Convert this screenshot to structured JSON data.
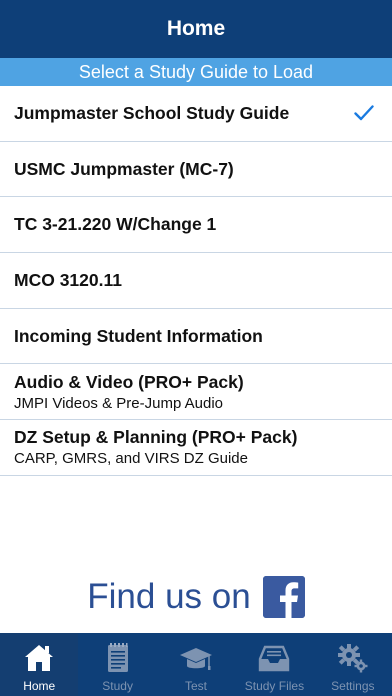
{
  "navbar": {
    "title": "Home"
  },
  "subheader": {
    "text": "Select a Study Guide to Load"
  },
  "list": [
    {
      "label": "Jumpmaster School Study Guide",
      "subtitle": "",
      "selected": true
    },
    {
      "label": "USMC Jumpmaster (MC-7)",
      "subtitle": ""
    },
    {
      "label": "TC 3-21.220 W/Change 1",
      "subtitle": ""
    },
    {
      "label": "MCO 3120.11",
      "subtitle": ""
    },
    {
      "label": "Incoming Student Information",
      "subtitle": ""
    },
    {
      "label": "Audio & Video (PRO+ Pack)",
      "subtitle": "JMPI Videos & Pre-Jump Audio"
    },
    {
      "label": "DZ Setup & Planning (PRO+ Pack)",
      "subtitle": "CARP, GMRS, and VIRS DZ Guide"
    }
  ],
  "facebook": {
    "text": "Find us on",
    "icon": "facebook-icon"
  },
  "tabs": [
    {
      "label": "Home",
      "icon": "home-icon",
      "active": true
    },
    {
      "label": "Study",
      "icon": "notebook-icon"
    },
    {
      "label": "Test",
      "icon": "graduation-cap-icon"
    },
    {
      "label": "Study Files",
      "icon": "inbox-tray-icon"
    },
    {
      "label": "Settings",
      "icon": "gears-icon"
    }
  ],
  "colors": {
    "navbar": "#0e3f78",
    "subheader": "#4fa3e3",
    "checkmark": "#1a7be0",
    "facebook_blue": "#3a5aa0",
    "tab_inactive": "#7d93b1",
    "tab_active": "#ffffff"
  }
}
